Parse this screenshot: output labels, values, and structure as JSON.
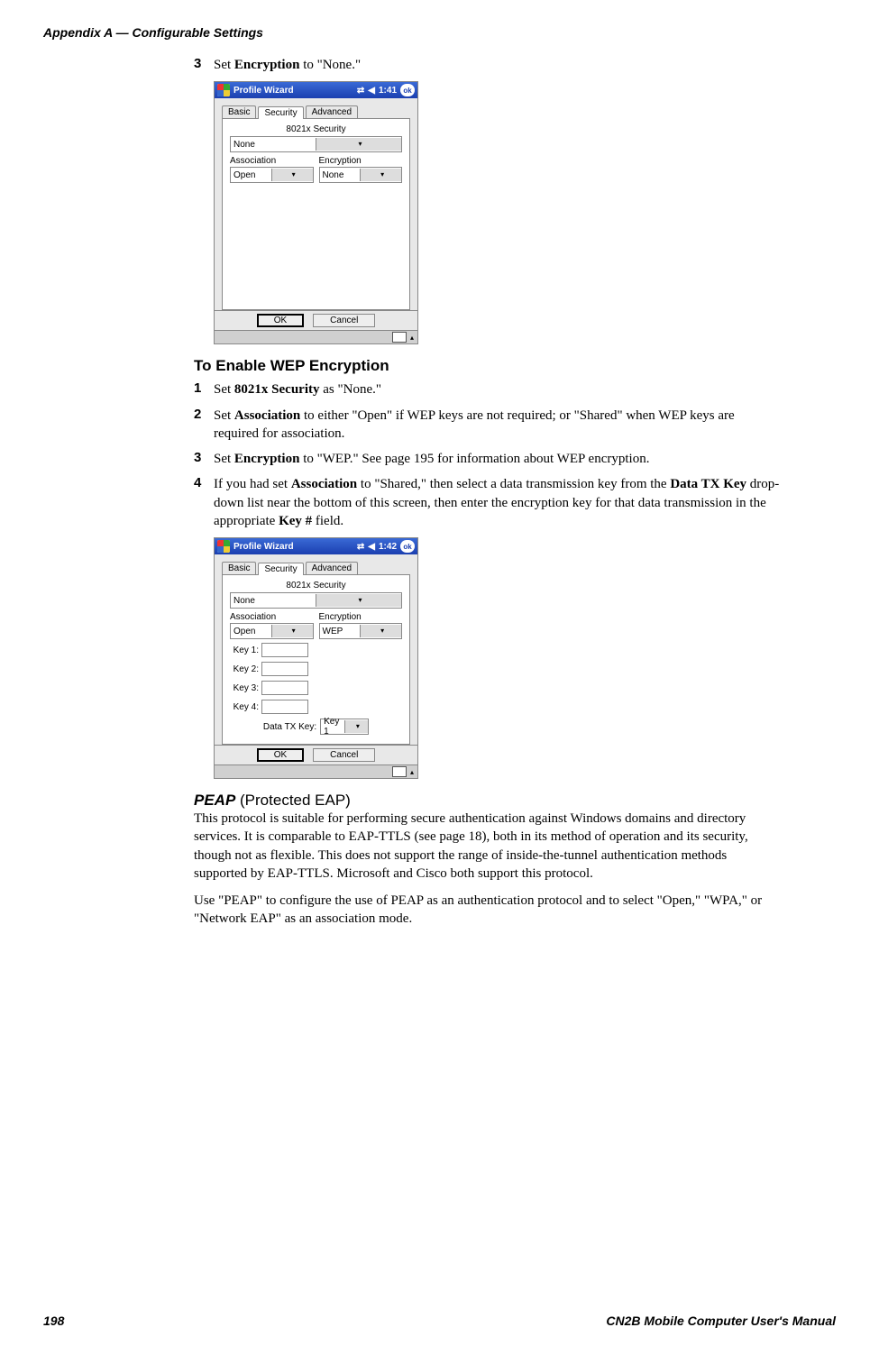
{
  "header": {
    "title": "Appendix A — Configurable Settings"
  },
  "step3_top": {
    "num": "3",
    "pre": "Set ",
    "bold": "Encryption",
    "post": " to \"None.\""
  },
  "shot1": {
    "title": "Profile Wizard",
    "time": "1:41",
    "ok": "ok",
    "tabs": {
      "basic": "Basic",
      "security": "Security",
      "advanced": "Advanced"
    },
    "group": "8021x Security",
    "sec_value": "None",
    "assoc_label": "Association",
    "assoc_value": "Open",
    "enc_label": "Encryption",
    "enc_value": "None",
    "btn_ok": "OK",
    "btn_cancel": "Cancel"
  },
  "sub1": "To Enable WEP Encryption",
  "s1": {
    "num": "1",
    "pre": "Set ",
    "b1": "8021x Security",
    "post": " as \"None.\""
  },
  "s2": {
    "num": "2",
    "pre": "Set ",
    "b1": "Association",
    "mid": " to either \"Open\" if WEP keys are not required; or \"Shared\" when WEP keys are required for association."
  },
  "s3": {
    "num": "3",
    "pre": "Set ",
    "b1": "Encryption",
    "post": " to \"WEP.\" See page 195 for information about WEP encryption."
  },
  "s4": {
    "num": "4",
    "pre": "If you had set ",
    "b1": "Association",
    "mid1": " to \"Shared,\" then select a data transmission key from the ",
    "b2": "Data TX Key",
    "mid2": " drop-down list near the bottom of this screen, then enter the encryption key for that data transmission in the appropriate ",
    "b3": "Key #",
    "post": " field."
  },
  "shot2": {
    "title": "Profile Wizard",
    "time": "1:42",
    "ok": "ok",
    "tabs": {
      "basic": "Basic",
      "security": "Security",
      "advanced": "Advanced"
    },
    "group": "8021x Security",
    "sec_value": "None",
    "assoc_label": "Association",
    "assoc_value": "Open",
    "enc_label": "Encryption",
    "enc_value": "WEP",
    "keys": {
      "k1": "Key 1:",
      "k2": "Key 2:",
      "k3": "Key 3:",
      "k4": "Key 4:"
    },
    "tx_label": "Data TX Key:",
    "tx_value": "Key 1",
    "btn_ok": "OK",
    "btn_cancel": "Cancel"
  },
  "peap": {
    "head_bold": "PEAP",
    "head_paren": " (Protected EAP)",
    "p1": "This protocol is suitable for performing secure authentication against Windows domains and directory services. It is comparable to EAP-TTLS (see page 18), both in its method of operation and its security, though not as flexible. This does not support the range of inside-the-tunnel authentication methods supported by EAP-TTLS. Microsoft and Cisco both support this protocol.",
    "p2": "Use \"PEAP\" to configure the use of PEAP as an authentication protocol and to select \"Open,\" \"WPA,\" or \"Network EAP\" as an association mode."
  },
  "footer": {
    "page": "198",
    "title": "CN2B Mobile Computer User's Manual"
  },
  "glyphs": {
    "conn": "⇄",
    "vol": "◀",
    "arrow_down": "▾",
    "arrow_up": "▴"
  }
}
